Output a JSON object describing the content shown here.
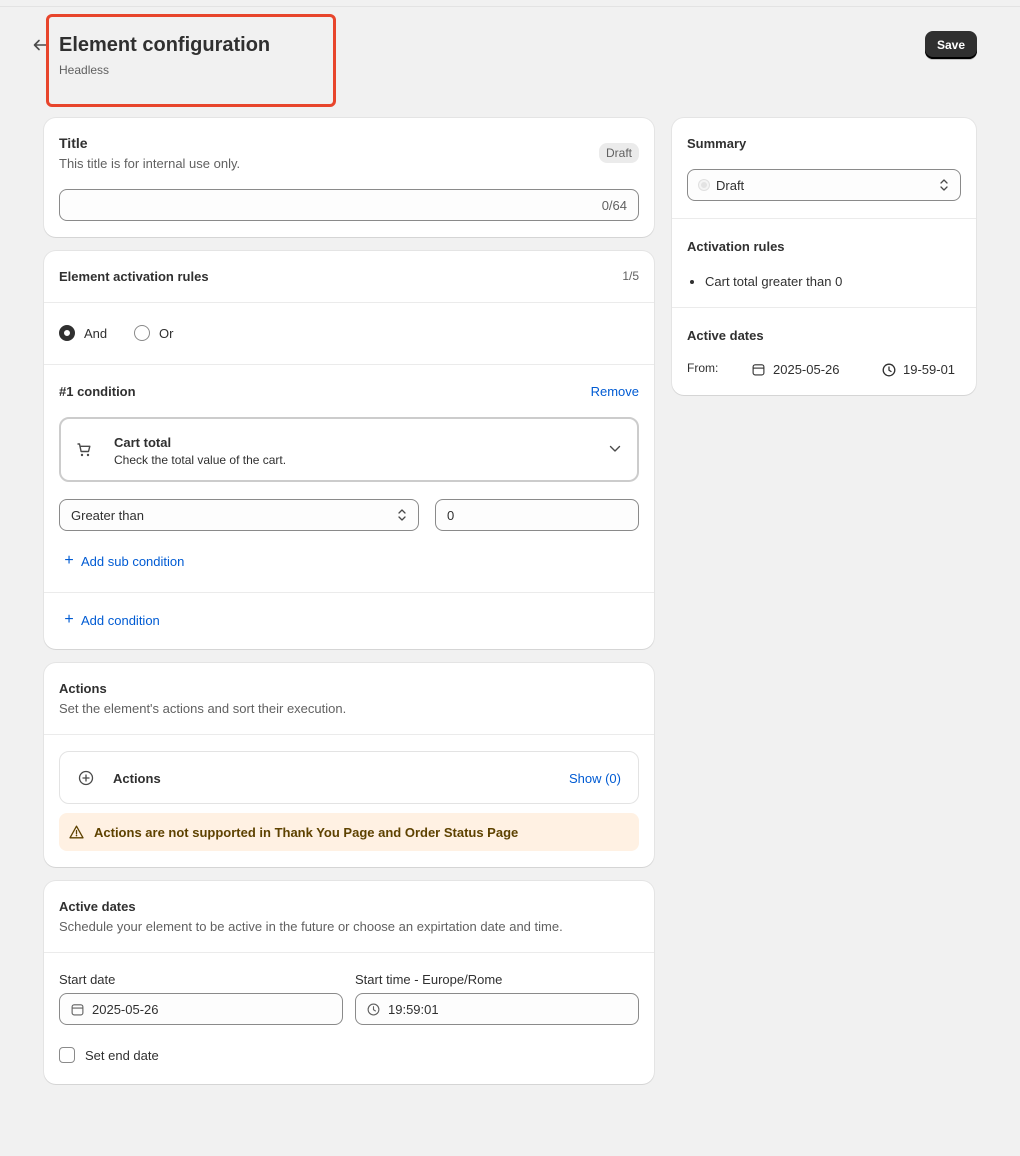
{
  "header": {
    "title": "Element configuration",
    "subtitle": "Headless",
    "save_label": "Save"
  },
  "title_card": {
    "heading": "Title",
    "help": "This title is for internal use only.",
    "badge": "Draft",
    "input_value": "",
    "counter": "0/64"
  },
  "rules_card": {
    "heading": "Element activation rules",
    "count": "1/5",
    "logic_options": [
      {
        "label": "And",
        "selected": true
      },
      {
        "label": "Or",
        "selected": false
      }
    ],
    "condition_title": "#1 condition",
    "remove_label": "Remove",
    "condition_type": {
      "title": "Cart total",
      "description": "Check the total value of the cart."
    },
    "operator_value": "Greater than",
    "amount_value": "0",
    "add_sub_condition": "Add sub condition",
    "add_condition": "Add condition"
  },
  "actions_card": {
    "heading": "Actions",
    "help": "Set the element's actions and sort their execution.",
    "row_label": "Actions",
    "show_label": "Show (0)",
    "warning": "Actions are not supported in Thank You Page and Order Status Page"
  },
  "dates_card": {
    "heading": "Active dates",
    "help": "Schedule your element to be active in the future or choose an expirtation date and time.",
    "start_date_label": "Start date",
    "start_date_value": "2025-05-26",
    "start_time_label": "Start time - Europe/Rome",
    "start_time_value": "19:59:01",
    "end_date_label": "Set end date"
  },
  "summary": {
    "heading": "Summary",
    "status_value": "Draft",
    "rules_heading": "Activation rules",
    "rules": [
      "Cart total greater than 0"
    ],
    "dates_heading": "Active dates",
    "from_label": "From:",
    "from_date": "2025-05-26",
    "from_time": "19-59-01"
  },
  "colors": {
    "accent_link": "#005bd3",
    "highlight_border": "#e8452c",
    "warning_bg": "#fff1e3",
    "primary_button": "#303030"
  }
}
